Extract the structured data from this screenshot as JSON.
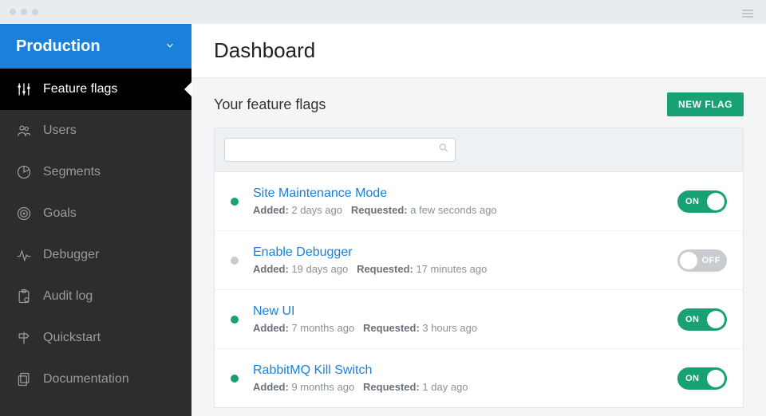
{
  "env": {
    "label": "Production"
  },
  "sidebar": {
    "items": [
      {
        "label": "Feature flags",
        "active": true
      },
      {
        "label": "Users"
      },
      {
        "label": "Segments"
      },
      {
        "label": "Goals"
      },
      {
        "label": "Debugger"
      },
      {
        "label": "Audit log"
      },
      {
        "label": "Quickstart"
      },
      {
        "label": "Documentation"
      }
    ]
  },
  "page": {
    "title": "Dashboard",
    "section_title": "Your feature flags",
    "new_flag_label": "NEW FLAG"
  },
  "search": {
    "placeholder": ""
  },
  "flags": [
    {
      "name": "Site Maintenance Mode",
      "added_label": "Added:",
      "added_value": "2 days ago",
      "requested_label": "Requested:",
      "requested_value": "a few seconds ago",
      "state": "on",
      "toggle_label": "ON"
    },
    {
      "name": "Enable Debugger",
      "added_label": "Added:",
      "added_value": "19 days ago",
      "requested_label": "Requested:",
      "requested_value": "17 minutes ago",
      "state": "off",
      "toggle_label": "OFF"
    },
    {
      "name": "New UI",
      "added_label": "Added:",
      "added_value": "7 months ago",
      "requested_label": "Requested:",
      "requested_value": "3 hours ago",
      "state": "on",
      "toggle_label": "ON"
    },
    {
      "name": "RabbitMQ Kill Switch",
      "added_label": "Added:",
      "added_value": "9 months ago",
      "requested_label": "Requested:",
      "requested_value": "1 day ago",
      "state": "on",
      "toggle_label": "ON"
    }
  ]
}
